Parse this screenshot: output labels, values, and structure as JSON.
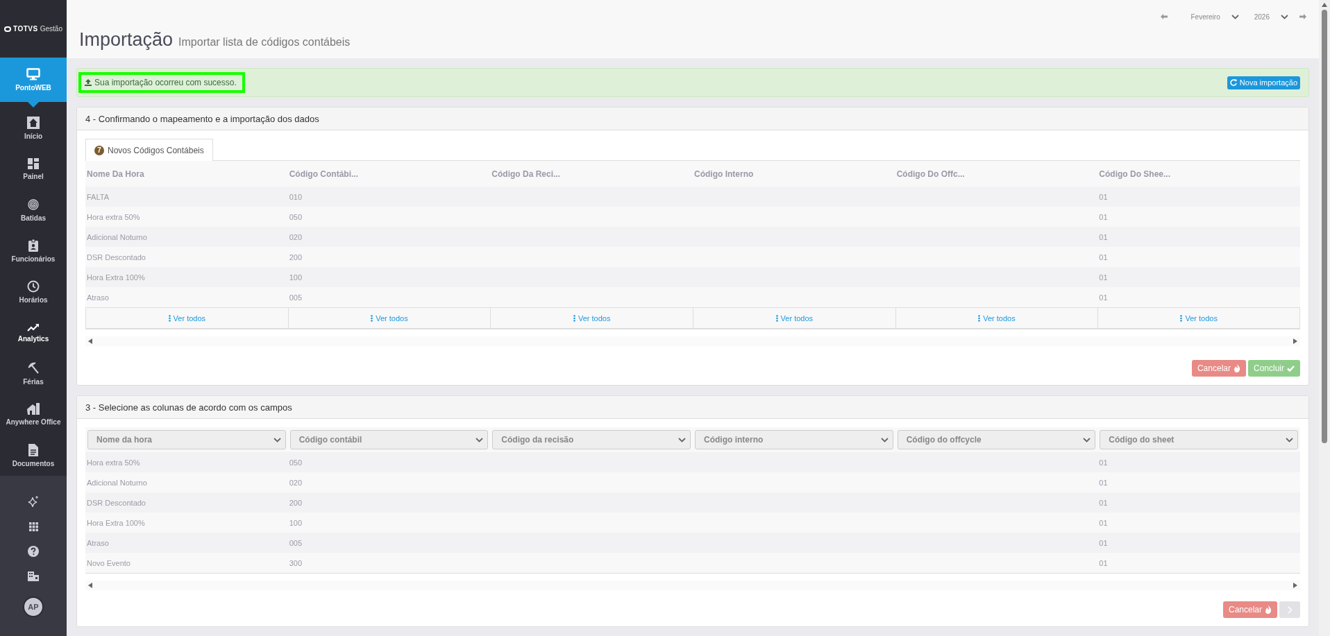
{
  "sidebar": {
    "logo": {
      "brand": "TOTVS",
      "product": "Gestão"
    },
    "items": [
      {
        "label": "PontoWEB",
        "selected": true
      },
      {
        "label": "Início",
        "selected": false
      },
      {
        "label": "Painel",
        "selected": false
      },
      {
        "label": "Batidas",
        "selected": false
      },
      {
        "label": "Funcionários",
        "selected": false
      },
      {
        "label": "Horários",
        "selected": false
      },
      {
        "label": "Analytics",
        "selected": false
      },
      {
        "label": "Férias",
        "selected": false
      },
      {
        "label": "Anywhere Office",
        "selected": false
      },
      {
        "label": "Documentos",
        "selected": false
      }
    ],
    "avatar": "AP"
  },
  "header": {
    "title": "Importação",
    "subtitle": "Importar lista de códigos contábeis",
    "month": "Fevereiro",
    "year": "2026"
  },
  "alert": {
    "message": "Sua importação ocorreu com sucesso.",
    "button": "Nova importação"
  },
  "step4": {
    "title": "4 - Confirmando o mapeamento e a importação dos dados",
    "tabs": [
      {
        "count": "7",
        "label": "Novos Códigos Contábeis",
        "selected": true
      }
    ],
    "columns": [
      "Nome Da Hora",
      "Código Contábi...",
      "Código Da Reci...",
      "Código Interno",
      "Código Do Offc...",
      "Código Do Shee..."
    ],
    "rows": [
      [
        "FALTA",
        "010",
        null,
        null,
        null,
        "01"
      ],
      [
        "Hora extra 50%",
        "050",
        null,
        null,
        null,
        "01"
      ],
      [
        "Adicional Noturno",
        "020",
        null,
        null,
        null,
        "01"
      ],
      [
        "DSR Descontado",
        "200",
        null,
        null,
        null,
        "01"
      ],
      [
        "Hora Extra 100%",
        "100",
        null,
        null,
        null,
        "01"
      ],
      [
        "Atraso",
        "005",
        null,
        null,
        null,
        "01"
      ]
    ],
    "view_all": [
      "Ver todos",
      "Ver todos",
      "Ver todos",
      "Ver todos",
      "Ver todos",
      "Ver todos"
    ],
    "cancel": "Cancelar",
    "confirm": "Concluir"
  },
  "step3": {
    "title": "3 - Selecione as colunas de acordo com os campos",
    "selects": [
      "Nome da hora",
      "Código contábil",
      "Código da recisão",
      "Código interno",
      "Código do offcycle",
      "Código do sheet"
    ],
    "rows": [
      [
        "Hora extra 50%",
        "050",
        null,
        null,
        null,
        "01"
      ],
      [
        "Adicional Noturno",
        "020",
        null,
        null,
        null,
        "01"
      ],
      [
        "DSR Descontado",
        "200",
        null,
        null,
        null,
        "01"
      ],
      [
        "Hora Extra 100%",
        "100",
        null,
        null,
        null,
        "01"
      ],
      [
        "Atraso",
        "005",
        null,
        null,
        null,
        "01"
      ],
      [
        "Novo Evento",
        "300",
        null,
        null,
        null,
        "01"
      ]
    ],
    "cancel": "Cancelar",
    "next_disabled": true
  }
}
